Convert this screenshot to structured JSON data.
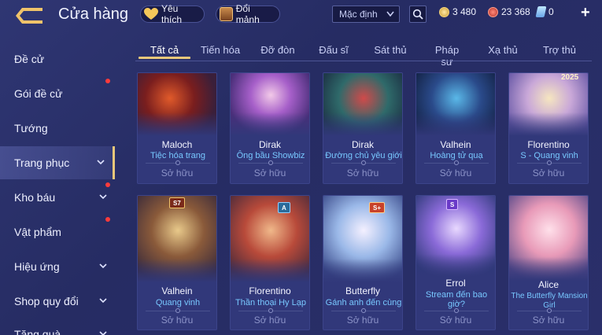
{
  "header": {
    "title": "Cửa hàng",
    "favorites_label": "Yêu thích",
    "exchange_label": "Đổi mảnh",
    "sort_selected": "Mặc định",
    "currencies": [
      {
        "icon": "gold-coin-icon",
        "value": "3 480"
      },
      {
        "icon": "ruby-icon",
        "value": "23 368"
      },
      {
        "icon": "voucher-icon",
        "value": "0"
      }
    ],
    "add_label": "+"
  },
  "sidebar": {
    "items": [
      {
        "label": "Đề cử",
        "active": false,
        "dot": false,
        "chevron": false
      },
      {
        "label": "Gói đề cử",
        "active": false,
        "dot": true,
        "chevron": false
      },
      {
        "label": "Tướng",
        "active": false,
        "dot": false,
        "chevron": false
      },
      {
        "label": "Trang phục",
        "active": true,
        "dot": false,
        "chevron": true
      },
      {
        "label": "Kho báu",
        "active": false,
        "dot": true,
        "chevron": true
      },
      {
        "label": "Vật phẩm",
        "active": false,
        "dot": true,
        "chevron": false
      },
      {
        "label": "Hiệu ứng",
        "active": false,
        "dot": false,
        "chevron": true
      },
      {
        "label": "Shop quy đổi",
        "active": false,
        "dot": false,
        "chevron": true
      },
      {
        "label": "Tặng quà",
        "active": false,
        "dot": false,
        "chevron": true
      }
    ]
  },
  "tabs": [
    {
      "label": "Tất cả",
      "active": true
    },
    {
      "label": "Tiến hóa",
      "active": false
    },
    {
      "label": "Đỡ đòn",
      "active": false
    },
    {
      "label": "Đấu sĩ",
      "active": false
    },
    {
      "label": "Sát thủ",
      "active": false
    },
    {
      "label": "Pháp sư",
      "active": false
    },
    {
      "label": "Xạ thủ",
      "active": false
    },
    {
      "label": "Trợ thủ",
      "active": false
    }
  ],
  "cards": [
    {
      "hero": "Maloch",
      "skin": "Tiệc hóa trang",
      "status": "Sở hữu",
      "badge": ""
    },
    {
      "hero": "Dirak",
      "skin": "Ông bầu Showbiz",
      "status": "Sở hữu",
      "badge": ""
    },
    {
      "hero": "Dirak",
      "skin": "Đường chủ yêu giới",
      "status": "Sở hữu",
      "badge": ""
    },
    {
      "hero": "Valhein",
      "skin": "Hoàng tử quạ",
      "status": "Sở hữu",
      "badge": ""
    },
    {
      "hero": "Florentino",
      "skin": "S - Quang vinh",
      "status": "Sở hữu",
      "badge": "2025"
    },
    {
      "hero": "Valhein",
      "skin": "Quang vinh",
      "status": "Sở hữu",
      "badge": "S7"
    },
    {
      "hero": "Florentino",
      "skin": "Thần thoại Hy Lạp",
      "status": "Sở hữu",
      "badge": "A"
    },
    {
      "hero": "Butterfly",
      "skin": "Gánh anh đến cùng",
      "status": "Sở hữu",
      "badge": "S+"
    },
    {
      "hero": "Errol",
      "skin": "Stream đến bao giờ?",
      "status": "Sở hữu",
      "badge": "S"
    },
    {
      "hero": "Alice",
      "skin": "The Butterfly Mansion Girl",
      "status": "Sở hữu",
      "badge": ""
    }
  ],
  "colors": {
    "accent_gold": "#e8c77a",
    "skin_name_blue": "#78c8ff",
    "notification_red": "#ff3b3b"
  }
}
